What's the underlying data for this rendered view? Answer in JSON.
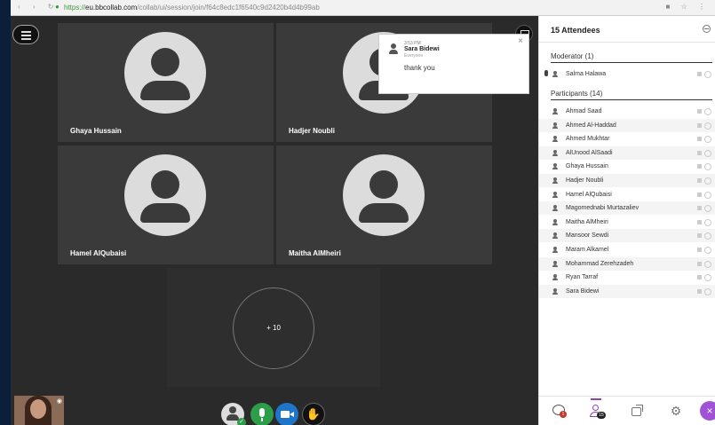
{
  "browser": {
    "url_proto": "https://",
    "url_host": "eu.bbcollab.com",
    "url_path": "/collab/ui/session/join/f64c8edc1f6540c9d2420b4d4b99ab"
  },
  "tiles": [
    {
      "name": "Ghaya Hussain"
    },
    {
      "name": "Hadjer Noubli"
    },
    {
      "name": "Hamel AlQubaisi"
    },
    {
      "name": "Maitha AlMheiri"
    }
  ],
  "more_tile": {
    "label": "+ 10"
  },
  "notification": {
    "time": "3:53 PM",
    "sender": "Sara Bidewi",
    "audience": "Everyone",
    "message": "thank you",
    "close": "×"
  },
  "panel": {
    "title": "15 Attendees",
    "moderator_label": "Moderator (1)",
    "moderators": [
      "Salma Halawa"
    ],
    "participants_label": "Participants (14)",
    "participants": [
      "Ahmad Saad",
      "Ahmed Al-Haddad",
      "Ahmed Mukhtar",
      "AlUnood AlSaadi",
      "Ghaya Hussain",
      "Hadjer Noubli",
      "Hamel AlQubaisi",
      "Magomednabi Murtazaliev",
      "Maitha AlMheiri",
      "Mansoor Sewdi",
      "Maram Alkamel",
      "Mohammad Zerehzadeh",
      "Ryan Tarraf",
      "Sara Bidewi"
    ]
  },
  "tabs": {
    "chat_badge": "1",
    "attendees_badge": "15",
    "gear_glyph": "⚙",
    "close_glyph": "×"
  },
  "icons": {
    "menu": "hamburger-icon",
    "screen": "screen-icon",
    "hand": "raise-hand-icon",
    "eye": "eye-icon"
  },
  "colors": {
    "accent": "#a052d6",
    "mic_on": "#2e9d4a",
    "camera": "#1d76c9",
    "badge_red": "#c0392b"
  }
}
